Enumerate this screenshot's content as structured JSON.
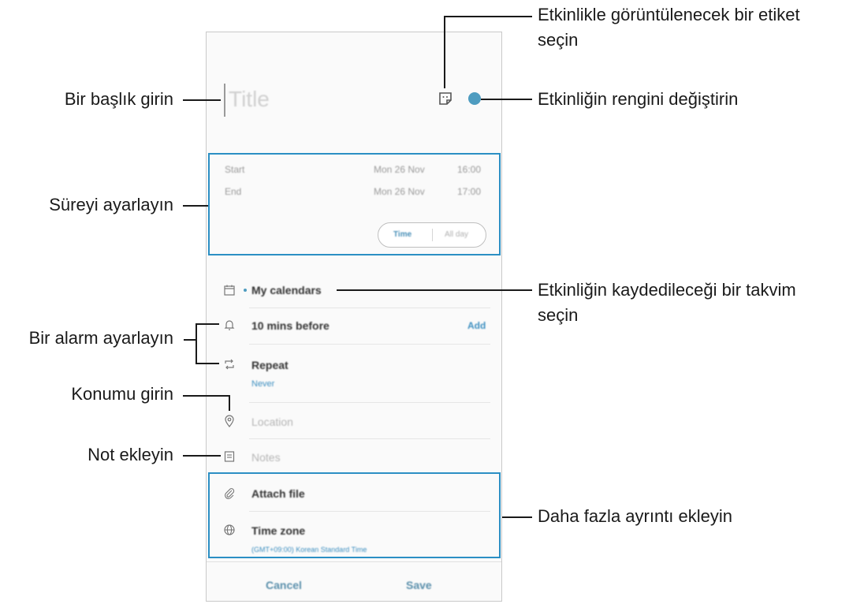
{
  "event": {
    "title_placeholder": "Title",
    "start_label": "Start",
    "start_date": "Mon 26 Nov",
    "start_time": "16:00",
    "end_label": "End",
    "end_date": "Mon 26 Nov",
    "end_time": "17:00",
    "time_toggle": "Time",
    "all_day_toggle": "All day",
    "calendar_label": "My calendars",
    "alarm_label": "10 mins before",
    "alarm_add": "Add",
    "repeat_label": "Repeat",
    "repeat_value": "Never",
    "location_placeholder": "Location",
    "notes_placeholder": "Notes",
    "attach_label": "Attach file",
    "timezone_label": "Time zone",
    "timezone_value": "(GMT+09:00) Korean Standard Time",
    "cancel_label": "Cancel",
    "save_label": "Save",
    "accent_color": "#4e9cc0"
  },
  "callouts": {
    "enter_title": "Bir başlık girin",
    "set_duration": "Süreyi ayarlayın",
    "set_alarm": "Bir alarm ayarlayın",
    "enter_location": "Konumu girin",
    "add_note": "Not ekleyin",
    "sticker_line1": "Etkinlikle görüntülenecek bir etiket",
    "sticker_line2": "seçin",
    "change_color": "Etkinliğin rengini değiştirin",
    "calendar_line1": "Etkinliğin kaydedileceği bir takvim",
    "calendar_line2": "seçin",
    "more_details": "Daha fazla ayrıntı ekleyin"
  },
  "icons": [
    "sticker-icon",
    "calendar-icon",
    "bell-icon",
    "repeat-icon",
    "location-pin-icon",
    "notes-icon",
    "paperclip-icon",
    "globe-icon"
  ]
}
